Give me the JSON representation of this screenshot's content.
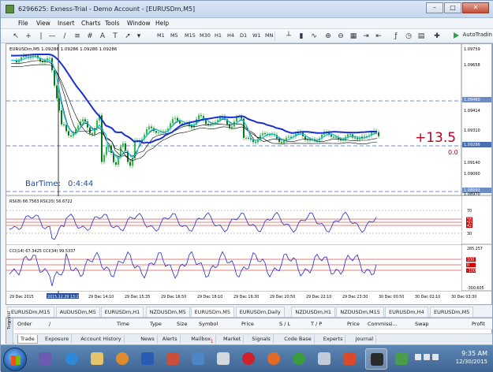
{
  "window": {
    "title": "6296625: Exness-Trial - Demo Account - [EURUSDm,M5]",
    "buttons": {
      "minimize": "–",
      "maximize": "□",
      "close": "✕"
    }
  },
  "menubar": [
    "File",
    "View",
    "Insert",
    "Charts",
    "Tools",
    "Window",
    "Help"
  ],
  "toolbar": {
    "timeframes": [
      "M1",
      "M5",
      "M15",
      "M30",
      "H1",
      "H4",
      "D1",
      "W1",
      "MN"
    ],
    "autotrading": "AutoTradin"
  },
  "chart": {
    "info": "EURUSDm,M5 1.09286 1.09286 1.09286 1.09286",
    "profit_big": "+13.5",
    "profit_small": "0.0",
    "bartime_label": "BarTime:",
    "bartime_value": "0:4:44",
    "price_labels": [
      "1.09759",
      "1.09658",
      "1.09460",
      "1.09414",
      "1.09310",
      "1.09286",
      "1.09140",
      "1.09060",
      "1.08993",
      "1.08970"
    ],
    "rsi": {
      "caption": "RSI(8) 66.7563  RSI(20) 56.6722",
      "levels": [
        "70",
        "58",
        "50",
        "42",
        "30"
      ]
    },
    "cci": {
      "caption": "CCI(14) 67.3425  CCI(34) 99.5337",
      "levels": [
        "285.257",
        "100",
        "0",
        "-100",
        "-300.605"
      ]
    },
    "time_labels": [
      "29 Dec 2015",
      "2015.12.29 13:25",
      "29 Dec 14:10",
      "29 Dec 15:35",
      "29 Dec 16:50",
      "29 Dec 18:10",
      "29 Dec 19:30",
      "29 Dec 20:50",
      "29 Dec 22:10",
      "29 Dec 23:30",
      "30 Dec 00:50",
      "30 Dec 02:10",
      "30 Dec 03:30"
    ]
  },
  "chart_tabs": [
    "EURUSDm,M15",
    "AUDUSDm,M5",
    "EURUSDm,H1",
    "NZDUSDm,M5",
    "EURUSDm,M5",
    "EURUSDm,Daily",
    "NZDUSDm,H1",
    "NZDUSDm,M15",
    "EURUSDm,H4",
    "EURUSDm,M5"
  ],
  "active_chart_tab": 4,
  "terminal": {
    "side_label": "Terminal",
    "columns": [
      "Order",
      "/",
      "Time",
      "Type",
      "Size",
      "Symbol",
      "Price",
      "S / L",
      "T / P",
      "Price",
      "Commissi...",
      "Swap",
      "Profit"
    ],
    "tabs": [
      "Trade",
      "Exposure",
      "Account History",
      "News",
      "Alerts",
      "Mailbox",
      "Market",
      "Signals",
      "Code Base",
      "Experts",
      "Journal"
    ],
    "mailbox_badge": "1"
  },
  "taskbar": {
    "time": "9:35 AM",
    "date": "12/30/2015"
  }
}
